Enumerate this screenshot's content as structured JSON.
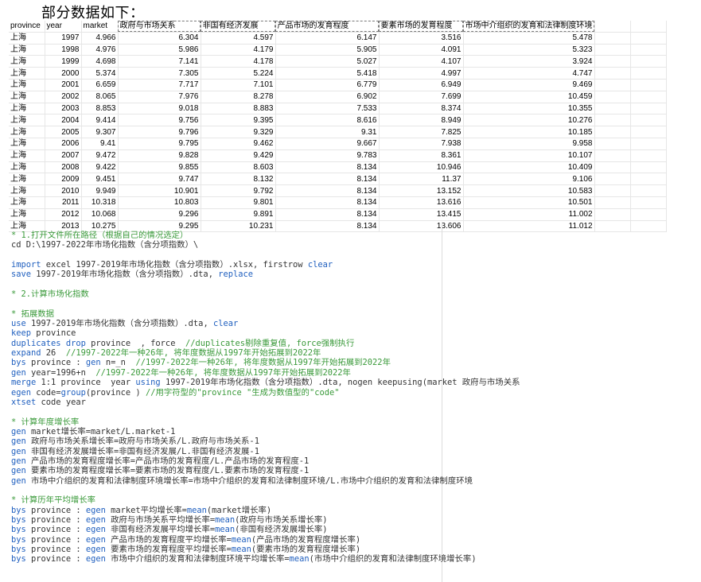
{
  "heading": "部分数据如下：",
  "table": {
    "headers": [
      "province",
      "year",
      "market",
      "政府与市场关系",
      "非国有经济发展",
      "产品市场的发育程度",
      "要素市场的发育程度",
      "市场中介组织的发育和法律制度环境"
    ],
    "rows": [
      [
        "上海",
        "1997",
        "4.966",
        "6.304",
        "4.597",
        "6.147",
        "3.516",
        "5.478"
      ],
      [
        "上海",
        "1998",
        "4.976",
        "5.986",
        "4.179",
        "5.905",
        "4.091",
        "5.323"
      ],
      [
        "上海",
        "1999",
        "4.698",
        "7.141",
        "4.178",
        "5.027",
        "4.107",
        "3.924"
      ],
      [
        "上海",
        "2000",
        "5.374",
        "7.305",
        "5.224",
        "5.418",
        "4.997",
        "4.747"
      ],
      [
        "上海",
        "2001",
        "6.659",
        "7.717",
        "7.101",
        "6.779",
        "6.949",
        "9.469"
      ],
      [
        "上海",
        "2002",
        "8.065",
        "7.976",
        "8.278",
        "6.902",
        "7.699",
        "10.459"
      ],
      [
        "上海",
        "2003",
        "8.853",
        "9.018",
        "8.883",
        "7.533",
        "8.374",
        "10.355"
      ],
      [
        "上海",
        "2004",
        "9.414",
        "9.756",
        "9.395",
        "8.616",
        "8.949",
        "10.276"
      ],
      [
        "上海",
        "2005",
        "9.307",
        "9.796",
        "9.329",
        "9.31",
        "7.825",
        "10.185"
      ],
      [
        "上海",
        "2006",
        "9.41",
        "9.795",
        "9.462",
        "9.667",
        "7.938",
        "9.958"
      ],
      [
        "上海",
        "2007",
        "9.472",
        "9.828",
        "9.429",
        "9.783",
        "8.361",
        "10.107"
      ],
      [
        "上海",
        "2008",
        "9.422",
        "9.855",
        "8.603",
        "8.134",
        "10.946",
        "10.409"
      ],
      [
        "上海",
        "2009",
        "9.451",
        "9.747",
        "8.132",
        "8.134",
        "11.37",
        "9.106"
      ],
      [
        "上海",
        "2010",
        "9.949",
        "10.901",
        "9.792",
        "8.134",
        "13.152",
        "10.583"
      ],
      [
        "上海",
        "2011",
        "10.318",
        "10.803",
        "9.801",
        "8.134",
        "13.616",
        "10.501"
      ],
      [
        "上海",
        "2012",
        "10.068",
        "9.296",
        "9.891",
        "8.134",
        "13.415",
        "11.002"
      ],
      [
        "上海",
        "2013",
        "10.275",
        "9.295",
        "10.231",
        "8.134",
        "13.606",
        "11.012"
      ]
    ]
  },
  "code_lines": [
    [
      [
        "com",
        "* 1.打开文件所在路径（根据自己的情况选定）"
      ]
    ],
    [
      [
        "txt",
        "cd D:\\1997-2022年市场化指数（含分项指数）\\"
      ]
    ],
    [],
    [
      [
        "kw",
        "import"
      ],
      [
        "txt",
        " excel 1997-2019年市场化指数（含分项指数）.xlsx, firstrow "
      ],
      [
        "kw",
        "clear"
      ]
    ],
    [
      [
        "kw",
        "save"
      ],
      [
        "txt",
        " 1997-2019年市场化指数（含分项指数）.dta, "
      ],
      [
        "kw",
        "replace"
      ]
    ],
    [],
    [
      [
        "com",
        "* 2.计算市场化指数"
      ]
    ],
    [],
    [
      [
        "com",
        "* 拓展数据"
      ]
    ],
    [
      [
        "kw",
        "use"
      ],
      [
        "txt",
        " 1997-2019年市场化指数（含分项指数）.dta, "
      ],
      [
        "kw",
        "clear"
      ]
    ],
    [
      [
        "kw",
        "keep"
      ],
      [
        "txt",
        " province"
      ]
    ],
    [
      [
        "kw",
        "duplicates drop"
      ],
      [
        "txt",
        " province  , force  "
      ],
      [
        "com",
        "//duplicates剔除重复值, force强制执行"
      ]
    ],
    [
      [
        "kw",
        "expand"
      ],
      [
        "txt",
        " 26  "
      ],
      [
        "com",
        "//1997-2022年一种26年, 将年度数据从1997年开始拓展到2022年"
      ]
    ],
    [
      [
        "kw",
        "bys"
      ],
      [
        "txt",
        " province : "
      ],
      [
        "kw",
        "gen"
      ],
      [
        "txt",
        " n=_n  "
      ],
      [
        "com",
        "//1997-2022年一种26年, 将年度数据从1997年开始拓展到2022年"
      ]
    ],
    [
      [
        "kw",
        "gen"
      ],
      [
        "txt",
        " year=1996+n  "
      ],
      [
        "com",
        "//1997-2022年一种26年, 将年度数据从1997年开始拓展到2022年"
      ]
    ],
    [
      [
        "kw",
        "merge"
      ],
      [
        "txt",
        " 1:1 province  year "
      ],
      [
        "kw",
        "using"
      ],
      [
        "txt",
        " 1997-2019年市场化指数（含分项指数）.dta, nogen keepusing(market 政府与市场关系"
      ]
    ],
    [
      [
        "kw",
        "egen"
      ],
      [
        "txt",
        " code="
      ],
      [
        "kw",
        "group"
      ],
      [
        "txt",
        "(province ) "
      ],
      [
        "com",
        "//用字符型的\"province \"生成为数值型的\"code\""
      ]
    ],
    [
      [
        "kw",
        "xtset"
      ],
      [
        "txt",
        " code year"
      ]
    ],
    [],
    [
      [
        "com",
        "* 计算年度增长率"
      ]
    ],
    [
      [
        "kw",
        "gen"
      ],
      [
        "txt",
        " market增长率=market/L.market-1"
      ]
    ],
    [
      [
        "kw",
        "gen"
      ],
      [
        "txt",
        " 政府与市场关系增长率=政府与市场关系/L.政府与市场关系-1"
      ]
    ],
    [
      [
        "kw",
        "gen"
      ],
      [
        "txt",
        " 非国有经济发展增长率=非国有经济发展/L.非国有经济发展-1"
      ]
    ],
    [
      [
        "kw",
        "gen"
      ],
      [
        "txt",
        " 产品市场的发育程度增长率=产品市场的发育程度/L.产品市场的发育程度-1"
      ]
    ],
    [
      [
        "kw",
        "gen"
      ],
      [
        "txt",
        " 要素市场的发育程度增长率=要素市场的发育程度/L.要素市场的发育程度-1"
      ]
    ],
    [
      [
        "kw",
        "gen"
      ],
      [
        "txt",
        " 市场中介组织的发育和法律制度环境增长率=市场中介组织的发育和法律制度环境/L.市场中介组织的发育和法律制度环境"
      ]
    ],
    [],
    [
      [
        "com",
        "* 计算历年平均增长率"
      ]
    ],
    [
      [
        "kw",
        "bys"
      ],
      [
        "txt",
        " province : "
      ],
      [
        "kw",
        "egen"
      ],
      [
        "txt",
        " market平均增长率="
      ],
      [
        "kw",
        "mean"
      ],
      [
        "txt",
        "(market增长率)"
      ]
    ],
    [
      [
        "kw",
        "bys"
      ],
      [
        "txt",
        " province : "
      ],
      [
        "kw",
        "egen"
      ],
      [
        "txt",
        " 政府与市场关系平均增长率="
      ],
      [
        "kw",
        "mean"
      ],
      [
        "txt",
        "(政府与市场关系增长率)"
      ]
    ],
    [
      [
        "kw",
        "bys"
      ],
      [
        "txt",
        " province : "
      ],
      [
        "kw",
        "egen"
      ],
      [
        "txt",
        " 非国有经济发展平均增长率="
      ],
      [
        "kw",
        "mean"
      ],
      [
        "txt",
        "(非国有经济发展增长率)"
      ]
    ],
    [
      [
        "kw",
        "bys"
      ],
      [
        "txt",
        " province : "
      ],
      [
        "kw",
        "egen"
      ],
      [
        "txt",
        " 产品市场的发育程度平均增长率="
      ],
      [
        "kw",
        "mean"
      ],
      [
        "txt",
        "(产品市场的发育程度增长率)"
      ]
    ],
    [
      [
        "kw",
        "bys"
      ],
      [
        "txt",
        " province : "
      ],
      [
        "kw",
        "egen"
      ],
      [
        "txt",
        " 要素市场的发育程度平均增长率="
      ],
      [
        "kw",
        "mean"
      ],
      [
        "txt",
        "(要素市场的发育程度增长率)"
      ]
    ],
    [
      [
        "kw",
        "bys"
      ],
      [
        "txt",
        " province : "
      ],
      [
        "kw",
        "egen"
      ],
      [
        "txt",
        " 市场中介组织的发育和法律制度环境平均增长率="
      ],
      [
        "kw",
        "mean"
      ],
      [
        "txt",
        "(市场中介组织的发育和法律制度环境增长率)"
      ]
    ]
  ]
}
